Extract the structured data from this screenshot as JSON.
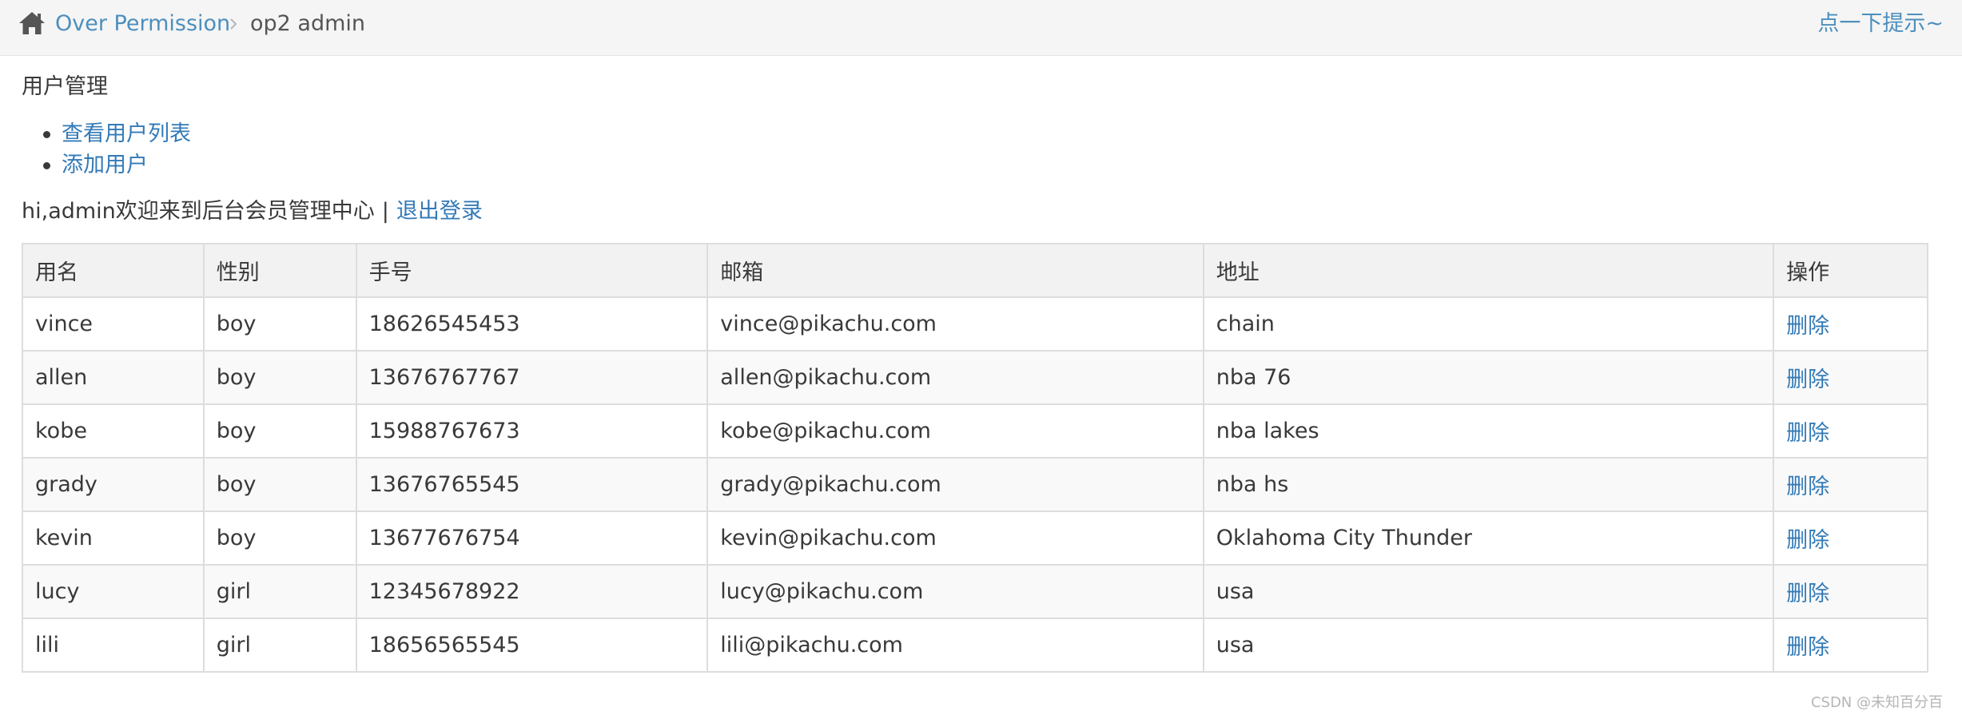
{
  "breadcrumb": {
    "home_icon": "home-icon",
    "parent_label": "Over Permission",
    "separator_icon": "chevron-right-icon",
    "current_label": "op2 admin",
    "hint_label": "点一下提示~"
  },
  "content": {
    "section_title": "用户管理",
    "menu": [
      {
        "label": "查看用户列表"
      },
      {
        "label": "添加用户"
      }
    ],
    "welcome_text": "hi,admin欢迎来到后台会员管理中心",
    "welcome_separator": "|",
    "logout_label": "退出登录"
  },
  "table": {
    "headers": {
      "name": "用名",
      "sex": "性别",
      "phone": "手号",
      "email": "邮箱",
      "address": "地址",
      "action": "操作"
    },
    "rows": [
      {
        "name": "vince",
        "sex": "boy",
        "phone": "18626545453",
        "email": "vince@pikachu.com",
        "address": "chain",
        "action": "删除"
      },
      {
        "name": "allen",
        "sex": "boy",
        "phone": "13676767767",
        "email": "allen@pikachu.com",
        "address": "nba 76",
        "action": "删除"
      },
      {
        "name": "kobe",
        "sex": "boy",
        "phone": "15988767673",
        "email": "kobe@pikachu.com",
        "address": "nba lakes",
        "action": "删除"
      },
      {
        "name": "grady",
        "sex": "boy",
        "phone": "13676765545",
        "email": "grady@pikachu.com",
        "address": "nba hs",
        "action": "删除"
      },
      {
        "name": "kevin",
        "sex": "boy",
        "phone": "13677676754",
        "email": "kevin@pikachu.com",
        "address": "Oklahoma City Thunder",
        "action": "删除"
      },
      {
        "name": "lucy",
        "sex": "girl",
        "phone": "12345678922",
        "email": "lucy@pikachu.com",
        "address": "usa",
        "action": "删除"
      },
      {
        "name": "lili",
        "sex": "girl",
        "phone": "18656565545",
        "email": "lili@pikachu.com",
        "address": "usa",
        "action": "删除"
      }
    ]
  },
  "watermark": "CSDN @未知百分百",
  "colors": {
    "link": "#337ab7",
    "breadcrumb_link": "#4c8fbd",
    "text": "#393939",
    "breadcrumb_bg": "#f5f5f5",
    "table_border": "#dddddd"
  }
}
